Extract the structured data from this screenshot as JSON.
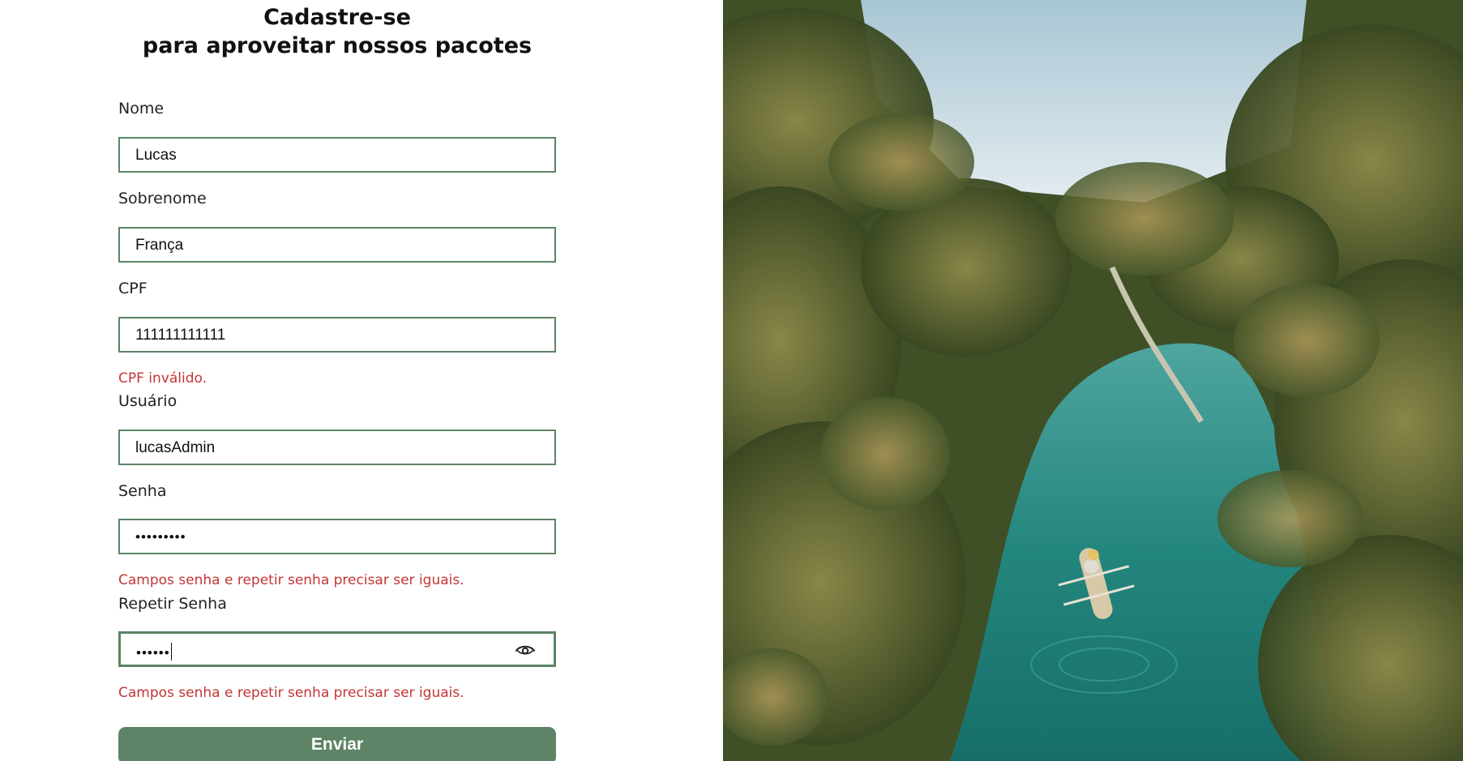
{
  "heading": {
    "line1": "Cadastre-se",
    "line2": "para aproveitar nossos pacotes"
  },
  "form": {
    "nome": {
      "label": "Nome",
      "value": "Lucas"
    },
    "sobrenome": {
      "label": "Sobrenome",
      "value": "França"
    },
    "cpf": {
      "label": "CPF",
      "value": "111111111111",
      "error": "CPF inválido."
    },
    "usuario": {
      "label": "Usuário",
      "value": "lucasAdmin"
    },
    "senha": {
      "label": "Senha",
      "value": "•••••••••",
      "error": "Campos senha e repetir senha precisar ser iguais."
    },
    "repetir_senha": {
      "label": "Repetir Senha",
      "value": "••••••",
      "error": "Campos senha e repetir senha precisar ser iguais."
    },
    "submit_label": "Enviar"
  },
  "icons": {
    "show_password": "eye-icon"
  },
  "colors": {
    "accent": "#5d8466",
    "error": "#c43535",
    "field_border": "#5b8466"
  }
}
